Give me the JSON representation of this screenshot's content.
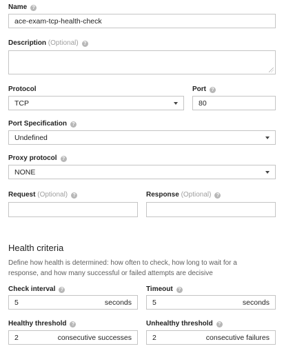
{
  "name": {
    "label": "Name",
    "value": "ace-exam-tcp-health-check"
  },
  "description": {
    "label": "Description",
    "optional": "(Optional)",
    "value": ""
  },
  "protocol": {
    "label": "Protocol",
    "value": "TCP"
  },
  "port": {
    "label": "Port",
    "value": "80"
  },
  "port_specification": {
    "label": "Port Specification",
    "value": "Undefined"
  },
  "proxy_protocol": {
    "label": "Proxy protocol",
    "value": "NONE"
  },
  "request": {
    "label": "Request",
    "optional": "(Optional)",
    "value": ""
  },
  "response": {
    "label": "Response",
    "optional": "(Optional)",
    "value": ""
  },
  "health_criteria": {
    "title": "Health criteria",
    "description_line1": "Define how health is determined: how often to check, how long to wait for a",
    "description_line2": "response, and how many successful or failed attempts are decisive"
  },
  "check_interval": {
    "label": "Check interval",
    "value": "5",
    "unit": "seconds"
  },
  "timeout": {
    "label": "Timeout",
    "value": "5",
    "unit": "seconds"
  },
  "healthy_threshold": {
    "label": "Healthy threshold",
    "value": "2",
    "unit": "consecutive successes"
  },
  "unhealthy_threshold": {
    "label": "Unhealthy threshold",
    "value": "2",
    "unit": "consecutive failures"
  },
  "icons": {
    "help": "help-icon",
    "dropdown": "chevron-down-icon"
  }
}
